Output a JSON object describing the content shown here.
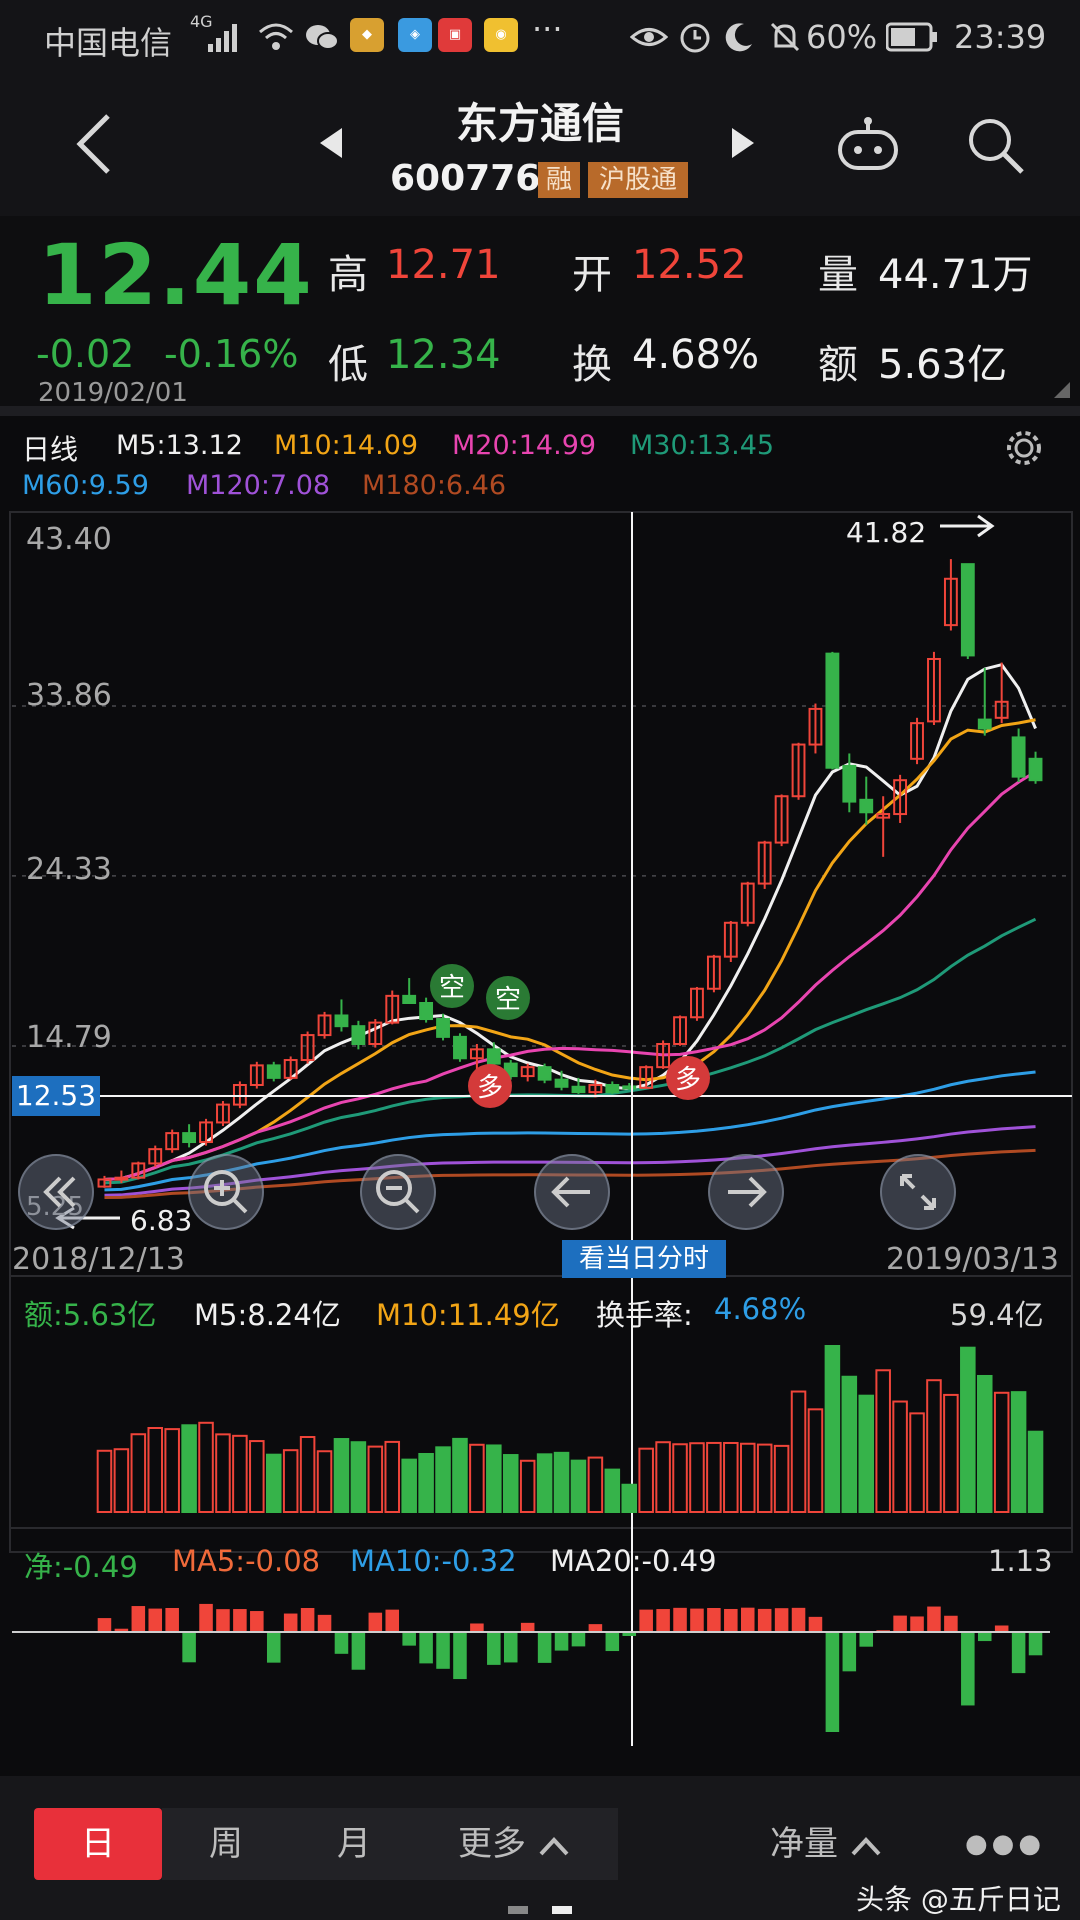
{
  "status_bar": {
    "carrier": "中国电信",
    "network": "4G",
    "battery": "60%",
    "time": "23:39",
    "more": "···",
    "app_icons": [
      "tiger-app",
      "jubao-app",
      "toutiao-app",
      "weibo-app"
    ]
  },
  "header": {
    "stock_name": "东方通信",
    "stock_code": "600776",
    "tag_margin": "融",
    "tag_connect": "沪股通"
  },
  "quote": {
    "price": "12.44",
    "change": "-0.02",
    "change_pct": "-0.16%",
    "date": "2019/02/01",
    "high_label": "高",
    "high_value": "12.71",
    "low_label": "低",
    "low_value": "12.34",
    "open_label": "开",
    "open_value": "12.52",
    "turnover_label": "换",
    "turnover_value": "4.68%",
    "volume_label": "量",
    "volume_value": "44.71万",
    "amount_label": "额",
    "amount_value": "5.63亿"
  },
  "kline": {
    "period_label": "日线",
    "ma": [
      {
        "label": "M5:13.12",
        "color": "#f0f0f0"
      },
      {
        "label": "M10:14.09",
        "color": "#f2a516"
      },
      {
        "label": "M20:14.99",
        "color": "#e845b0"
      },
      {
        "label": "M30:13.45",
        "color": "#1f9a78"
      },
      {
        "label": "M60:9.59",
        "color": "#2e9ee6"
      },
      {
        "label": "M120:7.08",
        "color": "#a052d8"
      },
      {
        "label": "M180:6.46",
        "color": "#b04a22"
      }
    ],
    "y_labels": [
      "43.40",
      "33.86",
      "24.33",
      "14.79"
    ],
    "crosshair_price": "12.53",
    "max_marker": "41.82",
    "min_marker": "6.83",
    "min_axis_label": "5.25",
    "date_start": "2018/12/13",
    "date_end": "2019/03/13",
    "intraday_button": "看当日分时",
    "signal_short": "空",
    "signal_long": "多"
  },
  "volume": {
    "amount": "额:5.63亿",
    "m5": "M5:8.24亿",
    "m10": "M10:11.49亿",
    "turnover_label": "换手率:",
    "turnover_value": "4.68%",
    "max": "59.4亿"
  },
  "netflow": {
    "net": "净:-0.49",
    "ma5": "MA5:-0.08",
    "ma10": "MA10:-0.32",
    "ma20": "MA20:-0.49",
    "max": "1.13"
  },
  "tabs": {
    "day": "日",
    "week": "周",
    "month": "月",
    "more": "更多",
    "net_volume": "净量",
    "dots": "●●●"
  },
  "watermark": "头条 @五斤日记",
  "colors": {
    "up": "#f0453a",
    "down": "#36b34a",
    "accent": "#e8303a"
  },
  "chart_data": {
    "type": "candlestick",
    "candles": [
      {
        "open": 6.9,
        "high": 7.5,
        "low": 6.83,
        "close": 7.3
      },
      {
        "open": 7.3,
        "high": 7.8,
        "low": 7.1,
        "close": 7.4
      },
      {
        "open": 7.4,
        "high": 8.3,
        "low": 7.3,
        "close": 8.2
      },
      {
        "open": 8.2,
        "high": 9.2,
        "low": 8.0,
        "close": 9.0
      },
      {
        "open": 9.0,
        "high": 10.1,
        "low": 8.8,
        "close": 9.9
      },
      {
        "open": 9.9,
        "high": 10.4,
        "low": 9.1,
        "close": 9.4
      },
      {
        "open": 9.4,
        "high": 10.7,
        "low": 9.2,
        "close": 10.5
      },
      {
        "open": 10.5,
        "high": 11.7,
        "low": 10.3,
        "close": 11.5
      },
      {
        "open": 11.5,
        "high": 12.8,
        "low": 11.3,
        "close": 12.6
      },
      {
        "open": 12.6,
        "high": 13.9,
        "low": 12.4,
        "close": 13.7
      },
      {
        "open": 13.7,
        "high": 13.9,
        "low": 12.8,
        "close": 13.0
      },
      {
        "open": 13.0,
        "high": 14.2,
        "low": 12.9,
        "close": 14.0
      },
      {
        "open": 14.0,
        "high": 15.6,
        "low": 13.8,
        "close": 15.4
      },
      {
        "open": 15.4,
        "high": 16.7,
        "low": 15.2,
        "close": 16.5
      },
      {
        "open": 16.5,
        "high": 17.4,
        "low": 15.6,
        "close": 15.9
      },
      {
        "open": 15.9,
        "high": 16.2,
        "low": 14.6,
        "close": 14.9
      },
      {
        "open": 14.9,
        "high": 16.3,
        "low": 14.7,
        "close": 16.1
      },
      {
        "open": 16.1,
        "high": 17.9,
        "low": 16.0,
        "close": 17.6
      },
      {
        "open": 17.6,
        "high": 18.6,
        "low": 17.3,
        "close": 17.2
      },
      {
        "open": 17.2,
        "high": 17.5,
        "low": 16.1,
        "close": 16.3
      },
      {
        "open": 16.3,
        "high": 16.6,
        "low": 15.1,
        "close": 15.3
      },
      {
        "open": 15.3,
        "high": 15.5,
        "low": 13.9,
        "close": 14.1
      },
      {
        "open": 14.1,
        "high": 14.9,
        "low": 13.4,
        "close": 14.6
      },
      {
        "open": 14.6,
        "high": 15.0,
        "low": 13.6,
        "close": 13.8
      },
      {
        "open": 13.8,
        "high": 14.0,
        "low": 12.9,
        "close": 13.1
      },
      {
        "open": 13.1,
        "high": 13.8,
        "low": 12.8,
        "close": 13.6
      },
      {
        "open": 13.6,
        "high": 13.8,
        "low": 12.7,
        "close": 12.9
      },
      {
        "open": 12.9,
        "high": 13.4,
        "low": 12.3,
        "close": 12.5
      },
      {
        "open": 12.5,
        "high": 13.0,
        "low": 12.1,
        "close": 12.2
      },
      {
        "open": 12.2,
        "high": 12.9,
        "low": 11.9,
        "close": 12.6
      },
      {
        "open": 12.6,
        "high": 12.8,
        "low": 12.1,
        "close": 12.2
      },
      {
        "open": 12.52,
        "high": 12.71,
        "low": 12.34,
        "close": 12.44
      },
      {
        "open": 12.44,
        "high": 13.7,
        "low": 12.4,
        "close": 13.6
      },
      {
        "open": 13.6,
        "high": 15.1,
        "low": 13.5,
        "close": 14.9
      },
      {
        "open": 14.9,
        "high": 16.5,
        "low": 14.8,
        "close": 16.4
      },
      {
        "open": 16.4,
        "high": 18.1,
        "low": 16.2,
        "close": 18.0
      },
      {
        "open": 18.0,
        "high": 19.9,
        "low": 17.8,
        "close": 19.8
      },
      {
        "open": 19.8,
        "high": 21.8,
        "low": 19.5,
        "close": 21.7
      },
      {
        "open": 21.7,
        "high": 24.0,
        "low": 21.5,
        "close": 23.9
      },
      {
        "open": 23.9,
        "high": 26.3,
        "low": 23.6,
        "close": 26.2
      },
      {
        "open": 26.2,
        "high": 28.9,
        "low": 26.0,
        "close": 28.8
      },
      {
        "open": 28.8,
        "high": 31.8,
        "low": 28.6,
        "close": 31.7
      },
      {
        "open": 31.7,
        "high": 34.0,
        "low": 31.2,
        "close": 33.7
      },
      {
        "open": 36.8,
        "high": 36.9,
        "low": 30.3,
        "close": 30.4
      },
      {
        "open": 30.5,
        "high": 31.2,
        "low": 27.9,
        "close": 28.5
      },
      {
        "open": 28.6,
        "high": 29.9,
        "low": 27.2,
        "close": 27.9
      },
      {
        "open": 27.6,
        "high": 28.8,
        "low": 25.4,
        "close": 27.8
      },
      {
        "open": 27.8,
        "high": 30.0,
        "low": 27.3,
        "close": 29.7
      },
      {
        "open": 30.9,
        "high": 33.2,
        "low": 30.6,
        "close": 32.9
      },
      {
        "open": 33.0,
        "high": 36.9,
        "low": 32.8,
        "close": 36.5
      },
      {
        "open": 38.4,
        "high": 42.1,
        "low": 38.1,
        "close": 41.0
      },
      {
        "open": 41.82,
        "high": 41.82,
        "low": 36.5,
        "close": 36.7
      },
      {
        "open": 33.1,
        "high": 36.0,
        "low": 32.2,
        "close": 32.6
      },
      {
        "open": 33.2,
        "high": 36.3,
        "low": 32.9,
        "close": 34.1
      },
      {
        "open": 32.1,
        "high": 32.6,
        "low": 29.6,
        "close": 29.9
      },
      {
        "open": 30.9,
        "high": 31.3,
        "low": 29.5,
        "close": 29.7
      }
    ],
    "ylim": [
      5.25,
      43.4
    ],
    "x_range": [
      "2018/12/13",
      "2019/03/13"
    ]
  }
}
